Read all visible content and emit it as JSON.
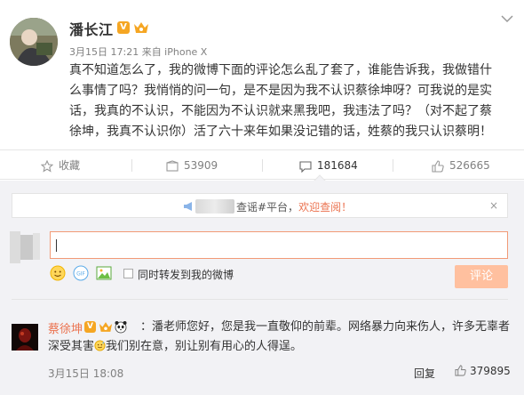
{
  "post": {
    "author": "潘长江",
    "verified_badge": "V",
    "timestamp": "3月15日 17:21 来自 iPhone X",
    "text": "真不知道怎么了，我的微博下面的评论怎么乱了套了，谁能告诉我，我做错什么事情了吗？我悄悄的问一句，是不是因为我不认识蔡徐坤呀？可我说的是实话，我真的不认识，不能因为不认识就来黑我吧，我违法了吗？（对不起了蔡徐坤，我真不认识你）活了六十来年如果没记错的话，姓蔡的我只认识蔡明！"
  },
  "actions": {
    "favorite_label": "收藏",
    "repost_count": "53909",
    "comment_count": "181684",
    "like_count": "526665"
  },
  "compose": {
    "notice_suffix": "查谣#平台，",
    "notice_link": "欢迎查阅！",
    "notice_close": "×",
    "repost_label": "同时转发到我的微博",
    "submit_label": "评论"
  },
  "comment": {
    "author": "蔡徐坤",
    "verified_badge": "V",
    "text_part1": "：潘老师您好，您是我一直敬仰的前辈。网络暴力向来伤人，许多无辜者深受其害",
    "text_part2": "我们别在意，别让别有用心的人得逞。",
    "timestamp": "3月15日 18:08",
    "reply_label": "回复",
    "like_count": "379895"
  },
  "colors": {
    "accent": "#eb7350",
    "submit_disabled": "#ffc09f",
    "badge": "#f5a623"
  }
}
